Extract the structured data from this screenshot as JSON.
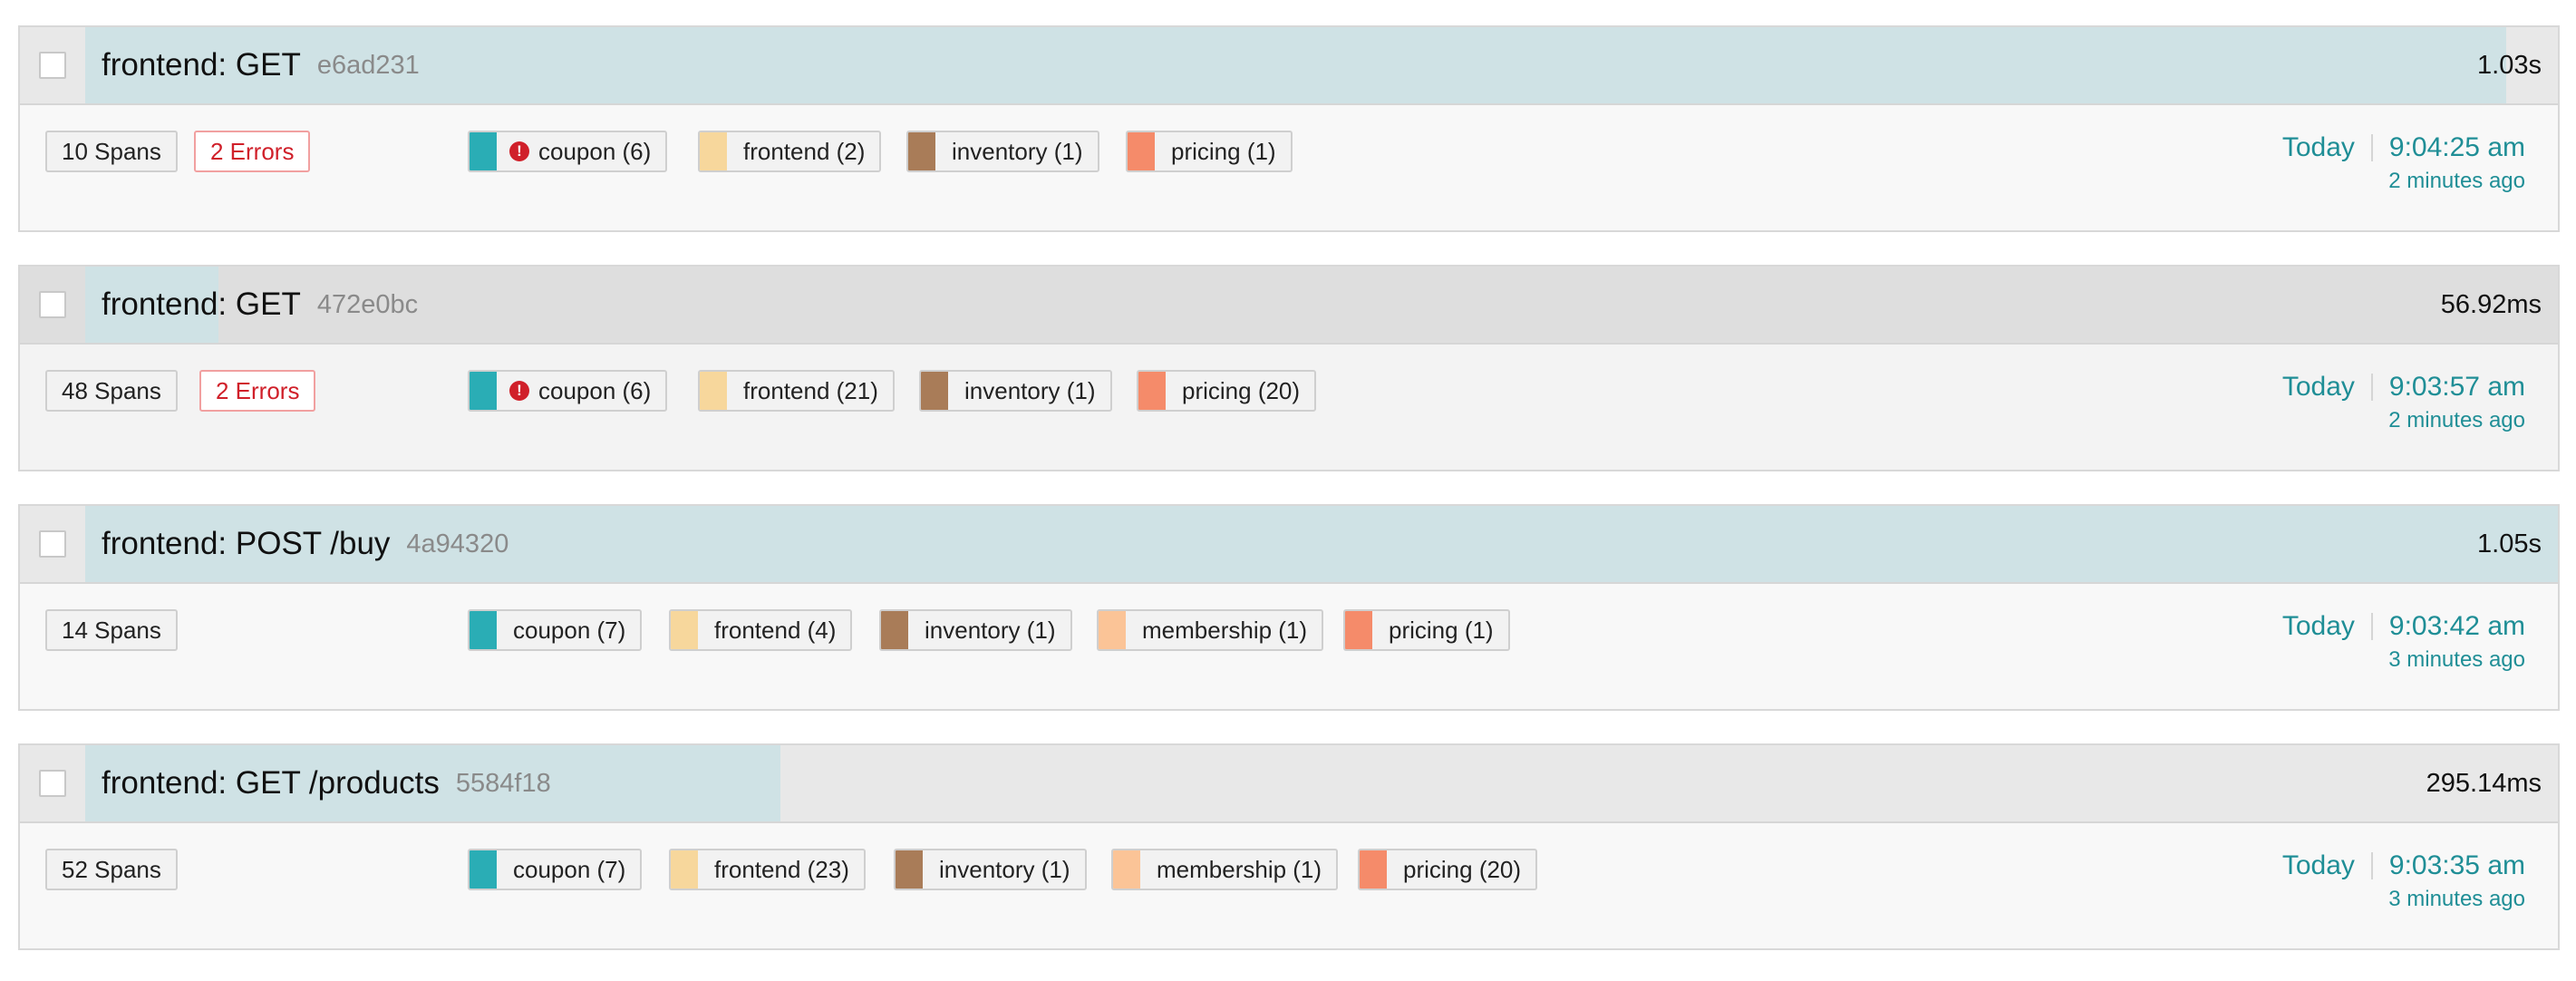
{
  "colors": {
    "coupon": "#2aadb5",
    "frontend": "#f7d79c",
    "inventory": "#a97c58",
    "membership": "#fbc497",
    "pricing": "#f58b6a",
    "accent": "#1f8e96",
    "error": "#d0202a"
  },
  "traces": [
    {
      "service": "frontend: GET",
      "trace_id": "e6ad231",
      "duration": "1.03s",
      "duration_fraction": 0.979,
      "spans": "10 Spans",
      "errors": "2 Errors",
      "services": [
        {
          "name": "coupon (6)",
          "has_error": true
        },
        {
          "name": "frontend (2)"
        },
        {
          "name": "inventory (1)"
        },
        {
          "name": "pricing (1)"
        }
      ],
      "day": "Today",
      "time": "9:04:25 am",
      "ago": "2 minutes ago"
    },
    {
      "service": "frontend: GET",
      "trace_id": "472e0bc",
      "duration": "56.92ms",
      "duration_fraction": 0.054,
      "spans": "48 Spans",
      "errors": "2 Errors",
      "services": [
        {
          "name": "coupon (6)",
          "has_error": true
        },
        {
          "name": "frontend (21)"
        },
        {
          "name": "inventory (1)"
        },
        {
          "name": "pricing (20)"
        }
      ],
      "day": "Today",
      "time": "9:03:57 am",
      "ago": "2 minutes ago"
    },
    {
      "service": "frontend: POST /buy",
      "trace_id": "4a94320",
      "duration": "1.05s",
      "duration_fraction": 1.0,
      "spans": "14 Spans",
      "services": [
        {
          "name": "coupon (7)"
        },
        {
          "name": "frontend (4)"
        },
        {
          "name": "inventory (1)"
        },
        {
          "name": "membership (1)"
        },
        {
          "name": "pricing (1)"
        }
      ],
      "day": "Today",
      "time": "9:03:42 am",
      "ago": "3 minutes ago"
    },
    {
      "service": "frontend: GET /products",
      "trace_id": "5584f18",
      "duration": "295.14ms",
      "duration_fraction": 0.281,
      "spans": "52 Spans",
      "services": [
        {
          "name": "coupon (7)"
        },
        {
          "name": "frontend (23)"
        },
        {
          "name": "inventory (1)"
        },
        {
          "name": "membership (1)"
        },
        {
          "name": "pricing (20)"
        }
      ],
      "day": "Today",
      "time": "9:03:35 am",
      "ago": "3 minutes ago"
    }
  ]
}
